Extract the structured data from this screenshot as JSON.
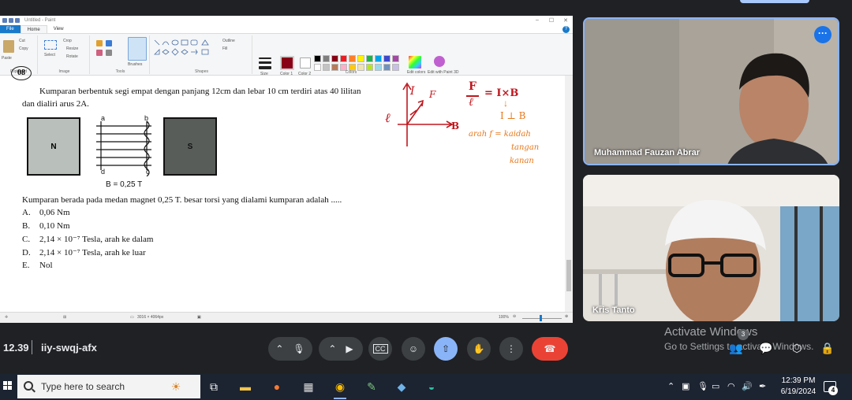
{
  "paint": {
    "title": "Untitled - Paint",
    "tabs": [
      "File",
      "Home",
      "View"
    ],
    "groups": [
      "Clipboard",
      "Image",
      "Tools",
      "Shapes",
      "Colors"
    ],
    "clipboard": {
      "paste": "Paste",
      "cut": "Cut",
      "copy": "Copy"
    },
    "image": {
      "crop": "Crop",
      "resize": "Resize",
      "rotate": "Rotate",
      "select": "Select"
    },
    "tools": {
      "brushes": "Brushes"
    },
    "shapes": {
      "outline": "Outline",
      "fill": "Fill"
    },
    "size": "Size",
    "color1": "Color 1",
    "color2": "Color 2",
    "edit_colors": "Edit colors",
    "edit_paint3d": "Edit with Paint 3D",
    "status_dimensions": "3016 × 4064px",
    "zoom": "100%",
    "palette": [
      "#000000",
      "#7f7f7f",
      "#880015",
      "#ed1c24",
      "#ff7f27",
      "#fff200",
      "#22b14c",
      "#00a2e8",
      "#3f48cc",
      "#a349a4",
      "#ffffff",
      "#c3c3c3",
      "#b97a57",
      "#ffaec9",
      "#ffc90e",
      "#efe4b0",
      "#b5e61d",
      "#99d9ea",
      "#7092be",
      "#c8bfe7"
    ]
  },
  "question": {
    "number": "08",
    "line1": "Kumparan berbentuk segi empat dengan panjang 12cm dan lebar 10 cm terdiri atas 40 lilitan",
    "line2": "dan dialiri arus 2A.",
    "magnet_n": "N",
    "magnet_s": "S",
    "coil_a": "a",
    "coil_b": "b",
    "coil_c": "c",
    "coil_d": "d",
    "field_label": "B = 0,25 T",
    "prompt": "Kumparan berada pada medan magnet 0,25 T. besar torsi yang dialami kumparan adalah .....",
    "options": [
      {
        "letter": "A.",
        "text": "0,06 Nm"
      },
      {
        "letter": "B.",
        "text": "0,10 Nm"
      },
      {
        "letter": "C.",
        "text": "2,14 × 10⁻⁷ Tesla, arah ke dalam"
      },
      {
        "letter": "D.",
        "text": "2,14 × 10⁻⁷ Tesla, arah ke luar"
      },
      {
        "letter": "E.",
        "text": "Nol"
      }
    ]
  },
  "annotation": {
    "axis_i": "I",
    "axis_f": "F",
    "axis_b": "B",
    "axis_l": "ℓ",
    "formula_top": "F",
    "formula_bottom": "ℓ",
    "formula_rhs": "= I×B",
    "perp": "I ⊥ B",
    "rule_line1": "arah f = kaidah",
    "rule_line2": "tangan",
    "rule_line3": "kanan",
    "ink_orange": "#e8771a",
    "ink_red": "#c0171e"
  },
  "participants": [
    {
      "name": "Muhammad Fauzan Abrar"
    },
    {
      "name": "Kris Tanto"
    }
  ],
  "meeting": {
    "time": "12.39",
    "code": "iiy-swqj-afx",
    "badge_count": "3",
    "leave_color": "#ea4335",
    "accent": "#8ab4f8"
  },
  "watermark": {
    "line1": "Activate Windows",
    "line2": "Go to Settings to activate Windows."
  },
  "taskbar": {
    "search_placeholder": "Type here to search",
    "time": "12:39 PM",
    "date": "6/19/2024",
    "notif_count": "4"
  }
}
